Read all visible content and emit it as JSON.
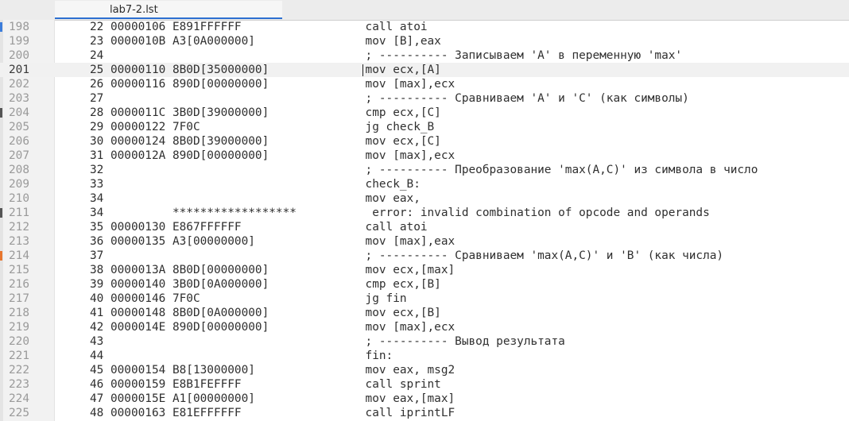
{
  "tab": {
    "title": "lab7-2.lst"
  },
  "editor": {
    "current_line": "201",
    "markers": [
      {
        "color": "#3c7ddb"
      },
      {
        "color": "#555555"
      },
      {
        "color": "#555555"
      },
      {
        "color": "#555555"
      },
      {
        "color": "#e8762e"
      }
    ],
    "lines": [
      {
        "num": "198",
        "text": "   22 00000106 E891FFFFFF                  call atoi"
      },
      {
        "num": "199",
        "text": "   23 0000010B A3[0A000000]                mov [B],eax"
      },
      {
        "num": "200",
        "text": "   24                                      ; ---------- Записываем 'A' в переменную 'max'"
      },
      {
        "num": "201",
        "text": "   25 00000110 8B0D[35000000]              mov ecx,[A]"
      },
      {
        "num": "202",
        "text": "   26 00000116 890D[00000000]              mov [max],ecx"
      },
      {
        "num": "203",
        "text": "   27                                      ; ---------- Сравниваем 'A' и 'C' (как символы)"
      },
      {
        "num": "204",
        "text": "   28 0000011C 3B0D[39000000]              cmp ecx,[C]"
      },
      {
        "num": "205",
        "text": "   29 00000122 7F0C                        jg check_B"
      },
      {
        "num": "206",
        "text": "   30 00000124 8B0D[39000000]              mov ecx,[C]"
      },
      {
        "num": "207",
        "text": "   31 0000012A 890D[00000000]              mov [max],ecx"
      },
      {
        "num": "208",
        "text": "   32                                      ; ---------- Преобразование 'max(A,C)' из символа в число"
      },
      {
        "num": "209",
        "text": "   33                                      check_B:"
      },
      {
        "num": "210",
        "text": "   34                                      mov eax,"
      },
      {
        "num": "211",
        "text": "   34          ******************           error: invalid combination of opcode and operands"
      },
      {
        "num": "212",
        "text": "   35 00000130 E867FFFFFF                  call atoi"
      },
      {
        "num": "213",
        "text": "   36 00000135 A3[00000000]                mov [max],eax"
      },
      {
        "num": "214",
        "text": "   37                                      ; ---------- Сравниваем 'max(A,C)' и 'B' (как числа)"
      },
      {
        "num": "215",
        "text": "   38 0000013A 8B0D[00000000]              mov ecx,[max]"
      },
      {
        "num": "216",
        "text": "   39 00000140 3B0D[0A000000]              cmp ecx,[B]"
      },
      {
        "num": "217",
        "text": "   40 00000146 7F0C                        jg fin"
      },
      {
        "num": "218",
        "text": "   41 00000148 8B0D[0A000000]              mov ecx,[B]"
      },
      {
        "num": "219",
        "text": "   42 0000014E 890D[00000000]              mov [max],ecx"
      },
      {
        "num": "220",
        "text": "   43                                      ; ---------- Вывод результата"
      },
      {
        "num": "221",
        "text": "   44                                      fin:"
      },
      {
        "num": "222",
        "text": "   45 00000154 B8[13000000]                mov eax, msg2"
      },
      {
        "num": "223",
        "text": "   46 00000159 E8B1FEFFFF                  call sprint"
      },
      {
        "num": "224",
        "text": "   47 0000015E A1[00000000]                mov eax,[max]"
      },
      {
        "num": "225",
        "text": "   48 00000163 E81EFFFFFF                  call iprintLF"
      }
    ]
  }
}
